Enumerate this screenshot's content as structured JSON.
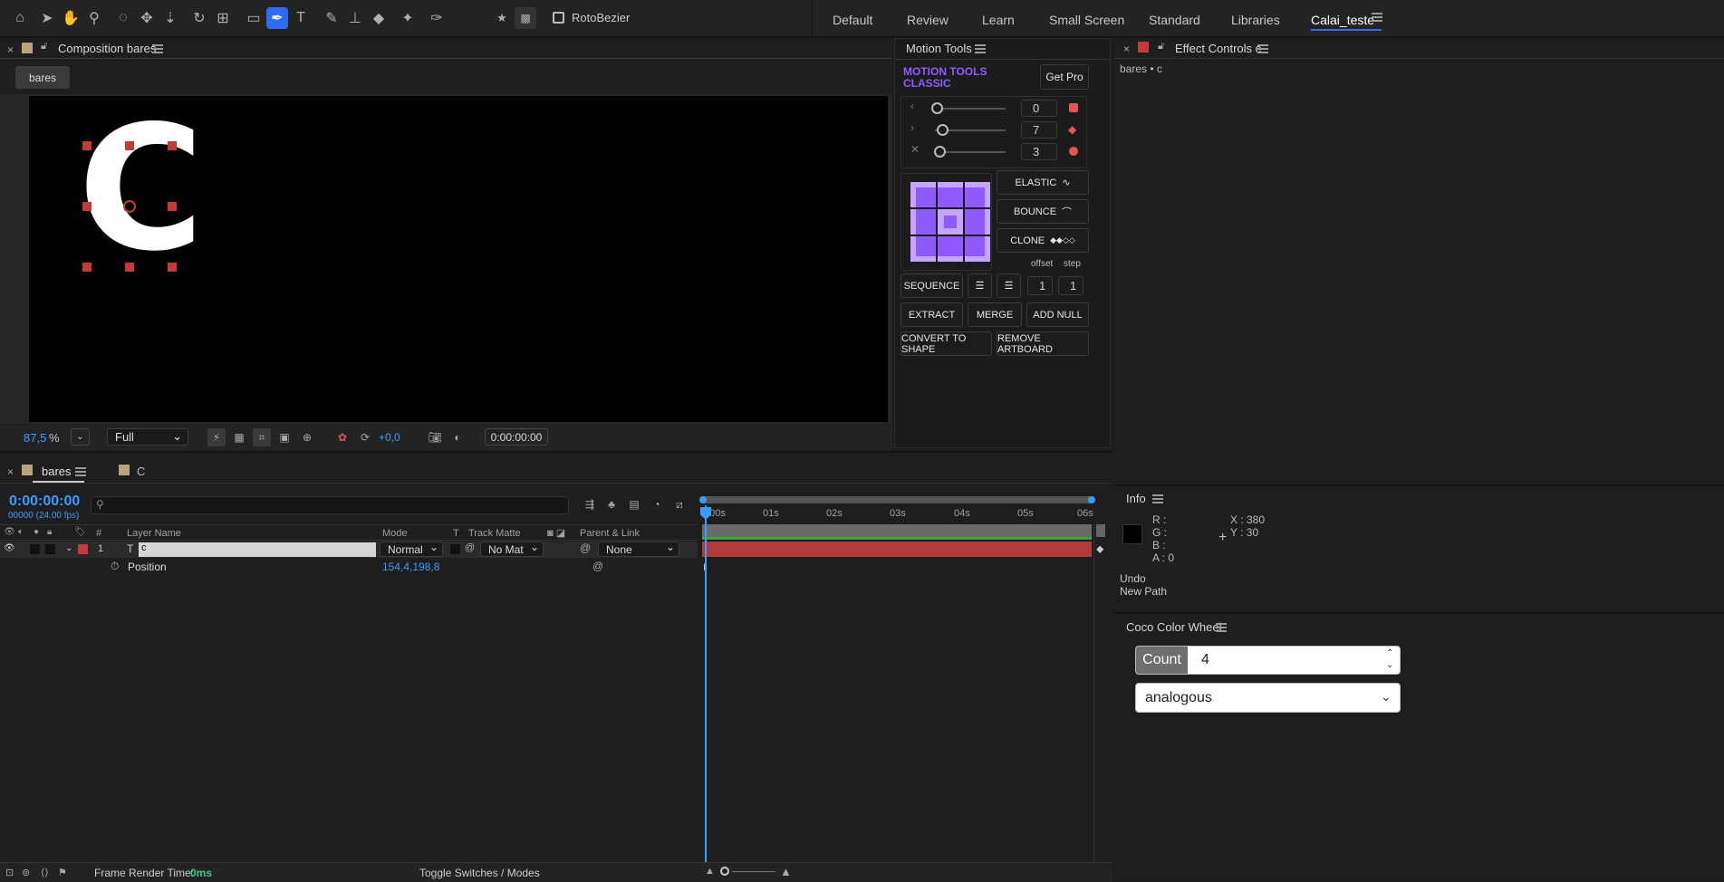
{
  "toolbar": {
    "tools": [
      "home-icon",
      "selection-icon",
      "hand-icon",
      "zoom-icon",
      "orbit-icon",
      "pan-icon",
      "dolly-icon",
      "rotate-icon",
      "anchor-icon",
      "rectangle-icon",
      "pen-icon",
      "type-icon",
      "brush-icon",
      "clone-stamp-icon",
      "eraser-icon",
      "roto-brush-icon",
      "puppet-pin-icon"
    ],
    "rotobezier_label": "RotoBezier",
    "workspaces": [
      "Default",
      "Review",
      "Learn",
      "Small Screen",
      "Standard",
      "Libraries",
      "Calai_teste"
    ],
    "active_workspace": "Calai_teste"
  },
  "composition": {
    "title": "Composition bares",
    "tab_label": "bares",
    "zoom": "87,5",
    "zoom_unit": "%",
    "resolution": "Full",
    "exposure": "+0,0",
    "timecode": "0:00:00:00",
    "letter": "C"
  },
  "motion_tools": {
    "panel_title": "Motion Tools",
    "brand_line1": "MOTION TOOLS",
    "brand_line2": "CLASSIC",
    "get_pro": "Get Pro",
    "slider_values": [
      "0",
      "7",
      "3"
    ],
    "elastic": "ELASTIC",
    "bounce": "BOUNCE",
    "clone": "CLONE",
    "offset_label": "offset",
    "step_label": "step",
    "sequence": "SEQUENCE",
    "offset_value": "1",
    "step_value": "1",
    "extract": "EXTRACT",
    "merge": "MERGE",
    "add_null": "ADD NULL",
    "convert_to_shape": "CONVERT TO SHAPE",
    "remove_artboard": "REMOVE ARTBOARD"
  },
  "effect_controls": {
    "title": "Effect Controls c",
    "breadcrumb": "bares • c"
  },
  "info": {
    "title": "Info",
    "r": "R :",
    "g": "G :",
    "b": "B :",
    "a": "A :  0",
    "x": "X : 380",
    "y": "Y : 30",
    "undo": "Undo",
    "last_action": "New Path"
  },
  "coco": {
    "title": "Coco Color Wheel",
    "count_label": "Count",
    "count_value": "4",
    "mode": "analogous"
  },
  "timeline": {
    "tab_main": "bares",
    "tab_second": "C",
    "timecode": "0:00:00:00",
    "frames": "00000 (24.00 fps)",
    "col_num": "#",
    "col_layer": "Layer Name",
    "col_mode": "Mode",
    "col_t": "T",
    "col_trackmatte": "Track Matte",
    "col_parent": "Parent & Link",
    "layer_index": "1",
    "layer_name": "c",
    "layer_mode": "Normal",
    "layer_matte": "No Mat",
    "layer_parent": "None",
    "prop_name": "Position",
    "prop_value": "154,4,198,8",
    "ruler": [
      "0:00s",
      "01s",
      "02s",
      "03s",
      "04s",
      "05s",
      "06s"
    ],
    "frame_render_label": "Frame Render Time:",
    "frame_render_value": "0ms",
    "toggle_label": "Toggle Switches / Modes"
  },
  "colors": {
    "accent": "#2d6df5",
    "brand_purple": "#8f5bff",
    "layer_bar": "#b13a3a",
    "timecode_blue": "#3b9cff"
  }
}
